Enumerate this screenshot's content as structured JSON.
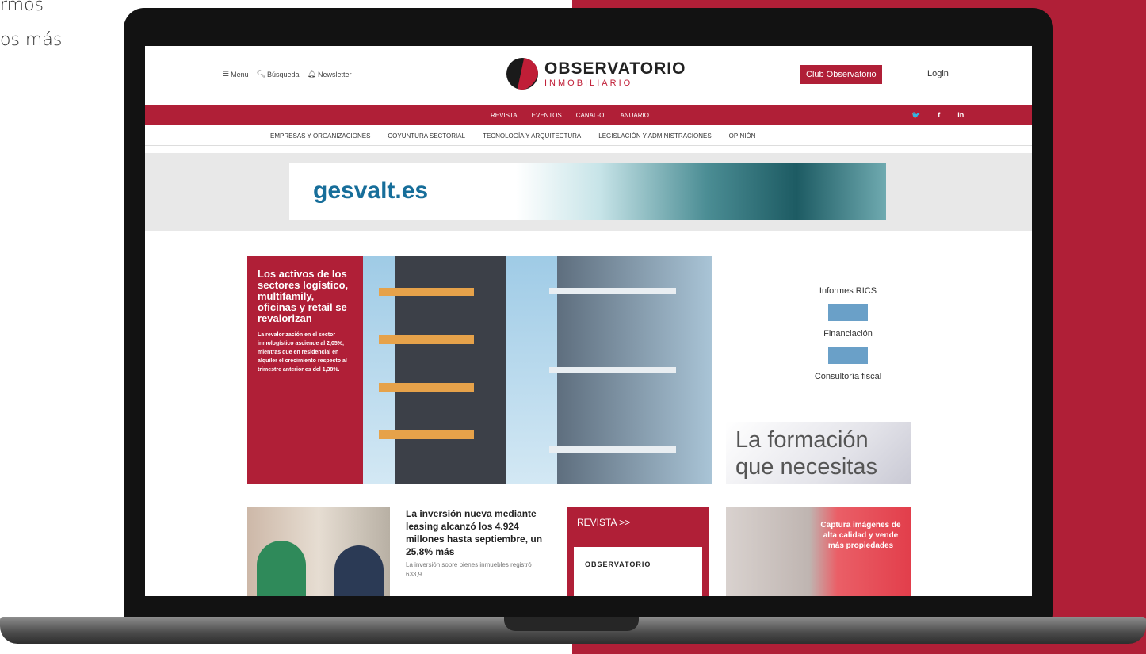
{
  "side_text": {
    "line1": "rmos",
    "line2": "os más"
  },
  "header": {
    "menu_label": "Menu",
    "search_label": "Búsqueda",
    "newsletter_label": "Newsletter",
    "logo_line1": "OBSERVATORIO",
    "logo_line2": "INMOBILIARIO",
    "club_label": "Club Observatorio",
    "login_label": "Login"
  },
  "nav_primary": [
    "REVISTA",
    "EVENTOS",
    "CANAL-OI",
    "ANUARIO"
  ],
  "social": [
    "twitter-icon",
    "facebook-icon",
    "linkedin-icon"
  ],
  "social_glyphs": [
    "🐦",
    "f",
    "in"
  ],
  "nav_secondary": [
    "EMPRESAS Y ORGANIZACIONES",
    "COYUNTURA SECTORIAL",
    "TECNOLOGÍA Y ARQUITECTURA",
    "LEGISLACIÓN Y ADMINISTRACIONES",
    "OPINIÓN"
  ],
  "banner": {
    "text": "gesvalt.es"
  },
  "hero": {
    "title": "Los activos de los sectores logístico, multifamily, oficinas y retail se revalorizan",
    "subtitle": "La revalorización en el sector inmologístico asciende al 2,05%, mientras que en residencial en alquiler el crecimiento respecto al trimestre anterior es del 1,38%."
  },
  "side_links": [
    "Informes RICS",
    "Financiación",
    "Consultoría fiscal"
  ],
  "ad_formacion": {
    "line1": "La formación",
    "line2": "que necesitas"
  },
  "article": {
    "title": "La inversión nueva mediante leasing alcanzó los 4.924 millones hasta septiembre, un 25,8% más",
    "snippet": "La inversión sobre bienes inmuebles registró 633,9"
  },
  "revista": {
    "label": "REVISTA >>",
    "mag_title": "OBSERVATORIO"
  },
  "captura": {
    "text": "Captura imágenes de alta calidad y vende más propiedades"
  },
  "colors": {
    "brand_red": "#b01f37",
    "link_blue": "#176e9a"
  }
}
